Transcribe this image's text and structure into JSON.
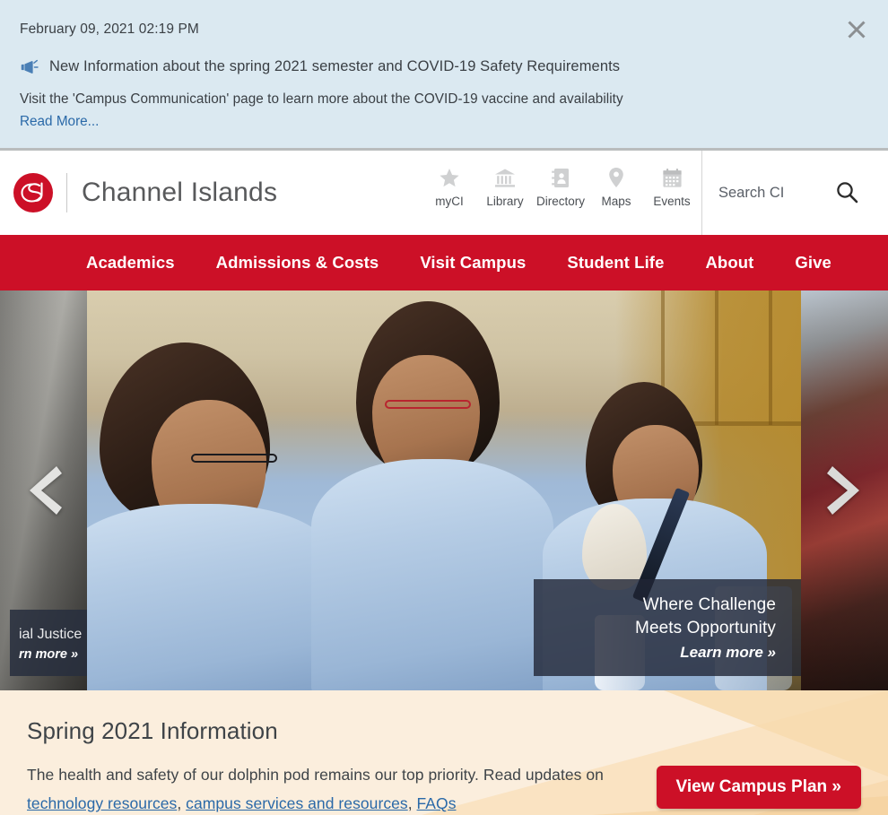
{
  "alert": {
    "date": "February 09, 2021 02:19 PM",
    "icon": "megaphone-icon",
    "headline": "New Information about the spring 2021 semester and COVID-19 Safety Requirements",
    "body": "Visit the 'Campus Communication' page to learn more about the COVID-19 vaccine and availability",
    "read_more": "Read More...",
    "close_icon": "close-icon",
    "background_color": "#dbe9f1",
    "link_color": "#2a69a8"
  },
  "header": {
    "logo_alt": "CSU",
    "site_name": "Channel Islands",
    "utility_nav": [
      {
        "label": "myCI",
        "icon": "star-icon"
      },
      {
        "label": "Library",
        "icon": "library-building-icon"
      },
      {
        "label": "Directory",
        "icon": "address-book-icon"
      },
      {
        "label": "Maps",
        "icon": "map-pin-icon"
      },
      {
        "label": "Events",
        "icon": "calendar-icon"
      }
    ],
    "search": {
      "placeholder": "Search CI",
      "value": "",
      "icon": "search-icon"
    }
  },
  "main_nav": {
    "accent_color": "#cc1027",
    "items": [
      {
        "label": "Academics"
      },
      {
        "label": "Admissions & Costs"
      },
      {
        "label": "Visit Campus"
      },
      {
        "label": "Student Life"
      },
      {
        "label": "About"
      },
      {
        "label": "Give"
      }
    ]
  },
  "hero": {
    "prev_arrow_icon": "chevron-left-icon",
    "next_arrow_icon": "chevron-right-icon",
    "previous_slide": {
      "caption_partial": "ial Justice",
      "link_partial": "rn more »"
    },
    "current_slide": {
      "caption_line1": "Where Challenge",
      "caption_line2": "Meets Opportunity",
      "link": "Learn more »"
    }
  },
  "info_panel": {
    "title": "Spring 2021 Information",
    "text_part1": "The health and safety of our dolphin pod remains our top priority. Read updates on ",
    "link1": "technology resources",
    "sep1": ", ",
    "link2": "campus services and resources",
    "sep2": ", ",
    "link3": "FAQs",
    "button_label": "View Campus Plan »",
    "background_color": "#fbeedd",
    "button_color": "#cc1027"
  }
}
